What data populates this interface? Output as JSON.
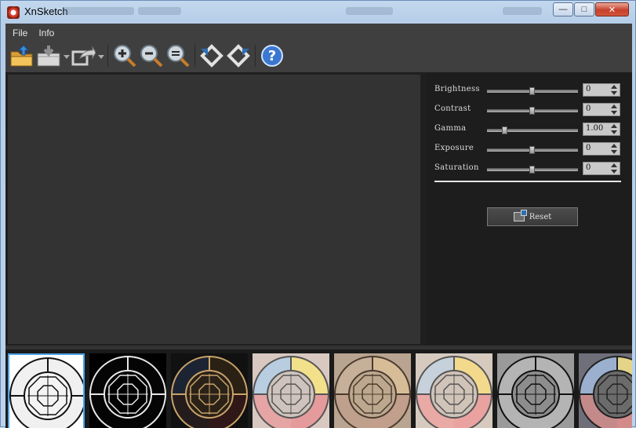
{
  "window": {
    "title": "XnSketch",
    "controls": [
      "minimize",
      "maximize",
      "close"
    ]
  },
  "menu": {
    "items": [
      {
        "label": "File"
      },
      {
        "label": "Info"
      }
    ]
  },
  "toolbar": {
    "buttons": [
      {
        "icon": "open-folder-icon"
      },
      {
        "icon": "save-icon"
      },
      {
        "icon": "export-icon"
      },
      {
        "icon": "zoom-in-icon"
      },
      {
        "icon": "zoom-out-icon"
      },
      {
        "icon": "zoom-fit-icon"
      },
      {
        "icon": "rotate-left-icon"
      },
      {
        "icon": "rotate-right-icon"
      },
      {
        "icon": "help-icon"
      }
    ]
  },
  "adjustments": [
    {
      "label": "Brightness",
      "value": "0",
      "position": 0.5
    },
    {
      "label": "Contrast",
      "value": "0",
      "position": 0.5
    },
    {
      "label": "Gamma",
      "value": "1.00",
      "position": 0.2
    },
    {
      "label": "Exposure",
      "value": "0",
      "position": 0.5
    },
    {
      "label": "Saturation",
      "value": "0",
      "position": 0.5
    }
  ],
  "reset": {
    "label": "Reset",
    "icon": "reset-icon"
  },
  "presets": [
    {
      "style": "bw-outline",
      "selected": true
    },
    {
      "style": "white-on-black"
    },
    {
      "style": "dark-color-edge"
    },
    {
      "style": "pastel-color"
    },
    {
      "style": "sepia-pencil"
    },
    {
      "style": "pastel-pencil"
    },
    {
      "style": "textured-gray"
    },
    {
      "style": "charcoal-color"
    }
  ],
  "colors": {
    "app_bg": "#3f3f3f",
    "canvas": "#333333",
    "panel": "#1d1d1d",
    "selection": "#4aa3e8"
  }
}
